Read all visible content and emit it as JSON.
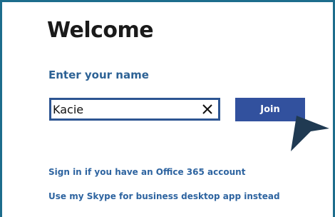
{
  "page": {
    "title": "Welcome",
    "name_label": "Enter your name"
  },
  "name_input": {
    "value": "Kacie",
    "clear_icon": "close-icon"
  },
  "join_button": {
    "label": "Join"
  },
  "links": {
    "sign_in": "Sign in if you have an Office 365 account",
    "desktop_app": "Use my Skype for business desktop app instead"
  },
  "colors": {
    "frame_border": "#1d6d8c",
    "accent_text": "#2d6295",
    "input_border": "#2d5592",
    "button_bg": "#32519e",
    "cursor": "#203a52"
  },
  "icons": {
    "pointer": "mouse-pointer-icon"
  }
}
